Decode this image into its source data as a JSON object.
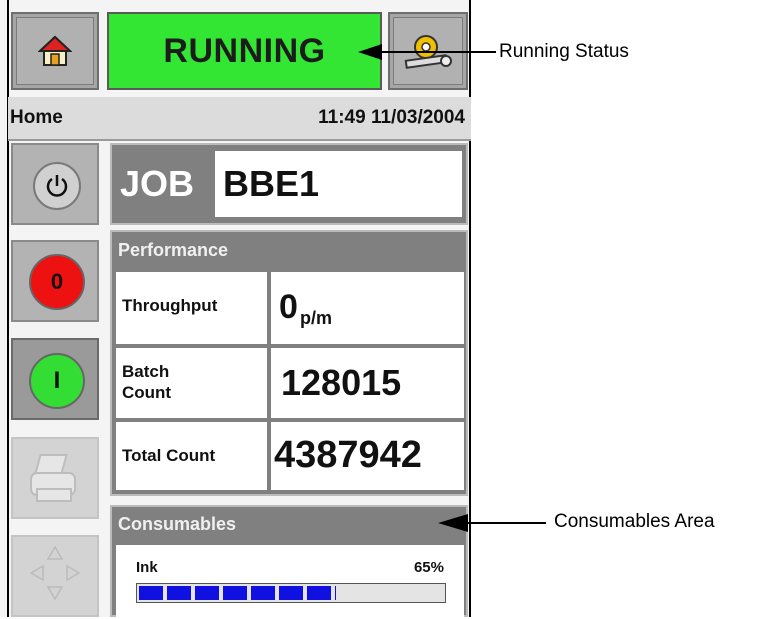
{
  "header": {
    "status": "RUNNING",
    "screen_name": "Home",
    "datetime": "11:49 11/03/2004"
  },
  "icons": {
    "home": "home-icon",
    "tools": "tools-icon",
    "power": "power-icon",
    "stop": "stop-icon",
    "start": "start-icon",
    "printer": "printer-icon",
    "navigation": "navigation-arrows-icon"
  },
  "side_buttons": {
    "stop_label": "0",
    "start_label": "I"
  },
  "job": {
    "label": "JOB",
    "name": "BBE1"
  },
  "performance": {
    "title": "Performance",
    "rows": [
      {
        "label": "Throughput",
        "value": "0",
        "unit": "p/m"
      },
      {
        "label": "Batch Count",
        "value": "128015"
      },
      {
        "label": "Total Count",
        "value": "4387942"
      }
    ]
  },
  "consumables": {
    "title": "Consumables",
    "ink_label": "Ink",
    "ink_percent_text": "65%",
    "ink_level_fraction": 0.65
  },
  "annotations": {
    "running_status": "Running Status",
    "consumables_area": "Consumables Area"
  },
  "colors": {
    "status_green": "#33e633",
    "stop_red": "#ee1111",
    "start_green": "#33dd33",
    "ink_blue": "#1010e0"
  }
}
